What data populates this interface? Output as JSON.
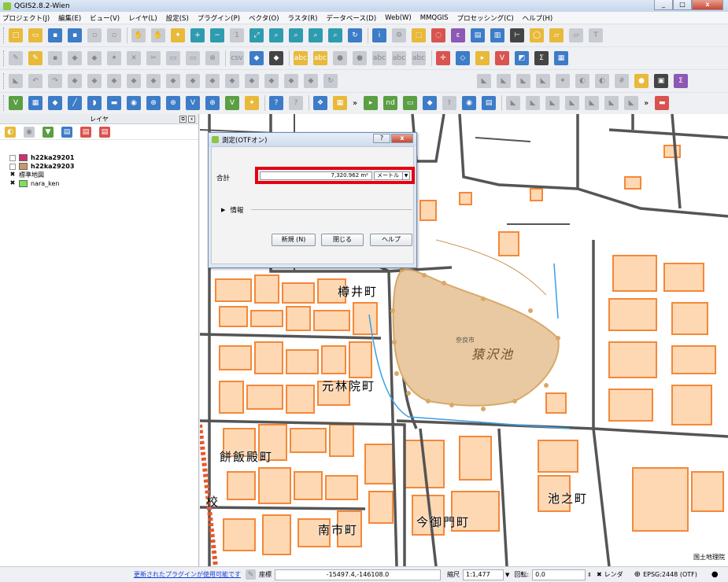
{
  "window": {
    "title": "QGIS2.8.2-Wien",
    "min": "_",
    "max": "□",
    "close": "x"
  },
  "menu": [
    "プロジェクト(J)",
    "編集(E)",
    "ビュー(V)",
    "レイヤ(L)",
    "設定(S)",
    "プラグイン(P)",
    "ベクタ(O)",
    "ラスタ(R)",
    "データベース(D)",
    "Web(W)",
    "MMQGIS",
    "プロセッシング(C)",
    "ヘルプ(H)"
  ],
  "layers_panel": {
    "title": "レイヤ",
    "layers": [
      {
        "name": "h22ka29201",
        "checked": false,
        "color": "#d12f6f"
      },
      {
        "name": "h22ka29203",
        "checked": false,
        "color": "#c49a6c"
      },
      {
        "name": "標準地図",
        "checked": true,
        "color": ""
      },
      {
        "name": "nara_ken",
        "checked": true,
        "color": "#7ee05a"
      }
    ]
  },
  "dialog": {
    "title": "測定(OTFオン)",
    "help_q": "?",
    "close": "x",
    "total_label": "合計",
    "value": "7,320.962 m²",
    "unit": "メートル",
    "info_label": "情報",
    "buttons": {
      "new": "新規 (N)",
      "close": "閉じる",
      "help": "ヘルプ"
    }
  },
  "map": {
    "labels": [
      "樽井町",
      "奈良市",
      "猿沢池",
      "元林院町",
      "餅飯殿町",
      "池之町",
      "南市町",
      "今御門町",
      "校"
    ],
    "attribution": "国土地理院"
  },
  "status": {
    "plugin_notice": "更新されたプラグインが使用可能です",
    "coord_label": "座標",
    "coord_value": "-15497.4,-146108.0",
    "scale_label": "縮尺",
    "scale_value": "1:1,477",
    "rotation_label": "回転:",
    "rotation_value": "0.0",
    "render_label": "レンダ",
    "crs": "EPSG:2448 (OTF)"
  },
  "colors": {
    "highlight": "#e60012",
    "building_fill": "#fdd8b3",
    "building_stroke": "#f4883a",
    "pond_fill": "#e9c9a1"
  }
}
